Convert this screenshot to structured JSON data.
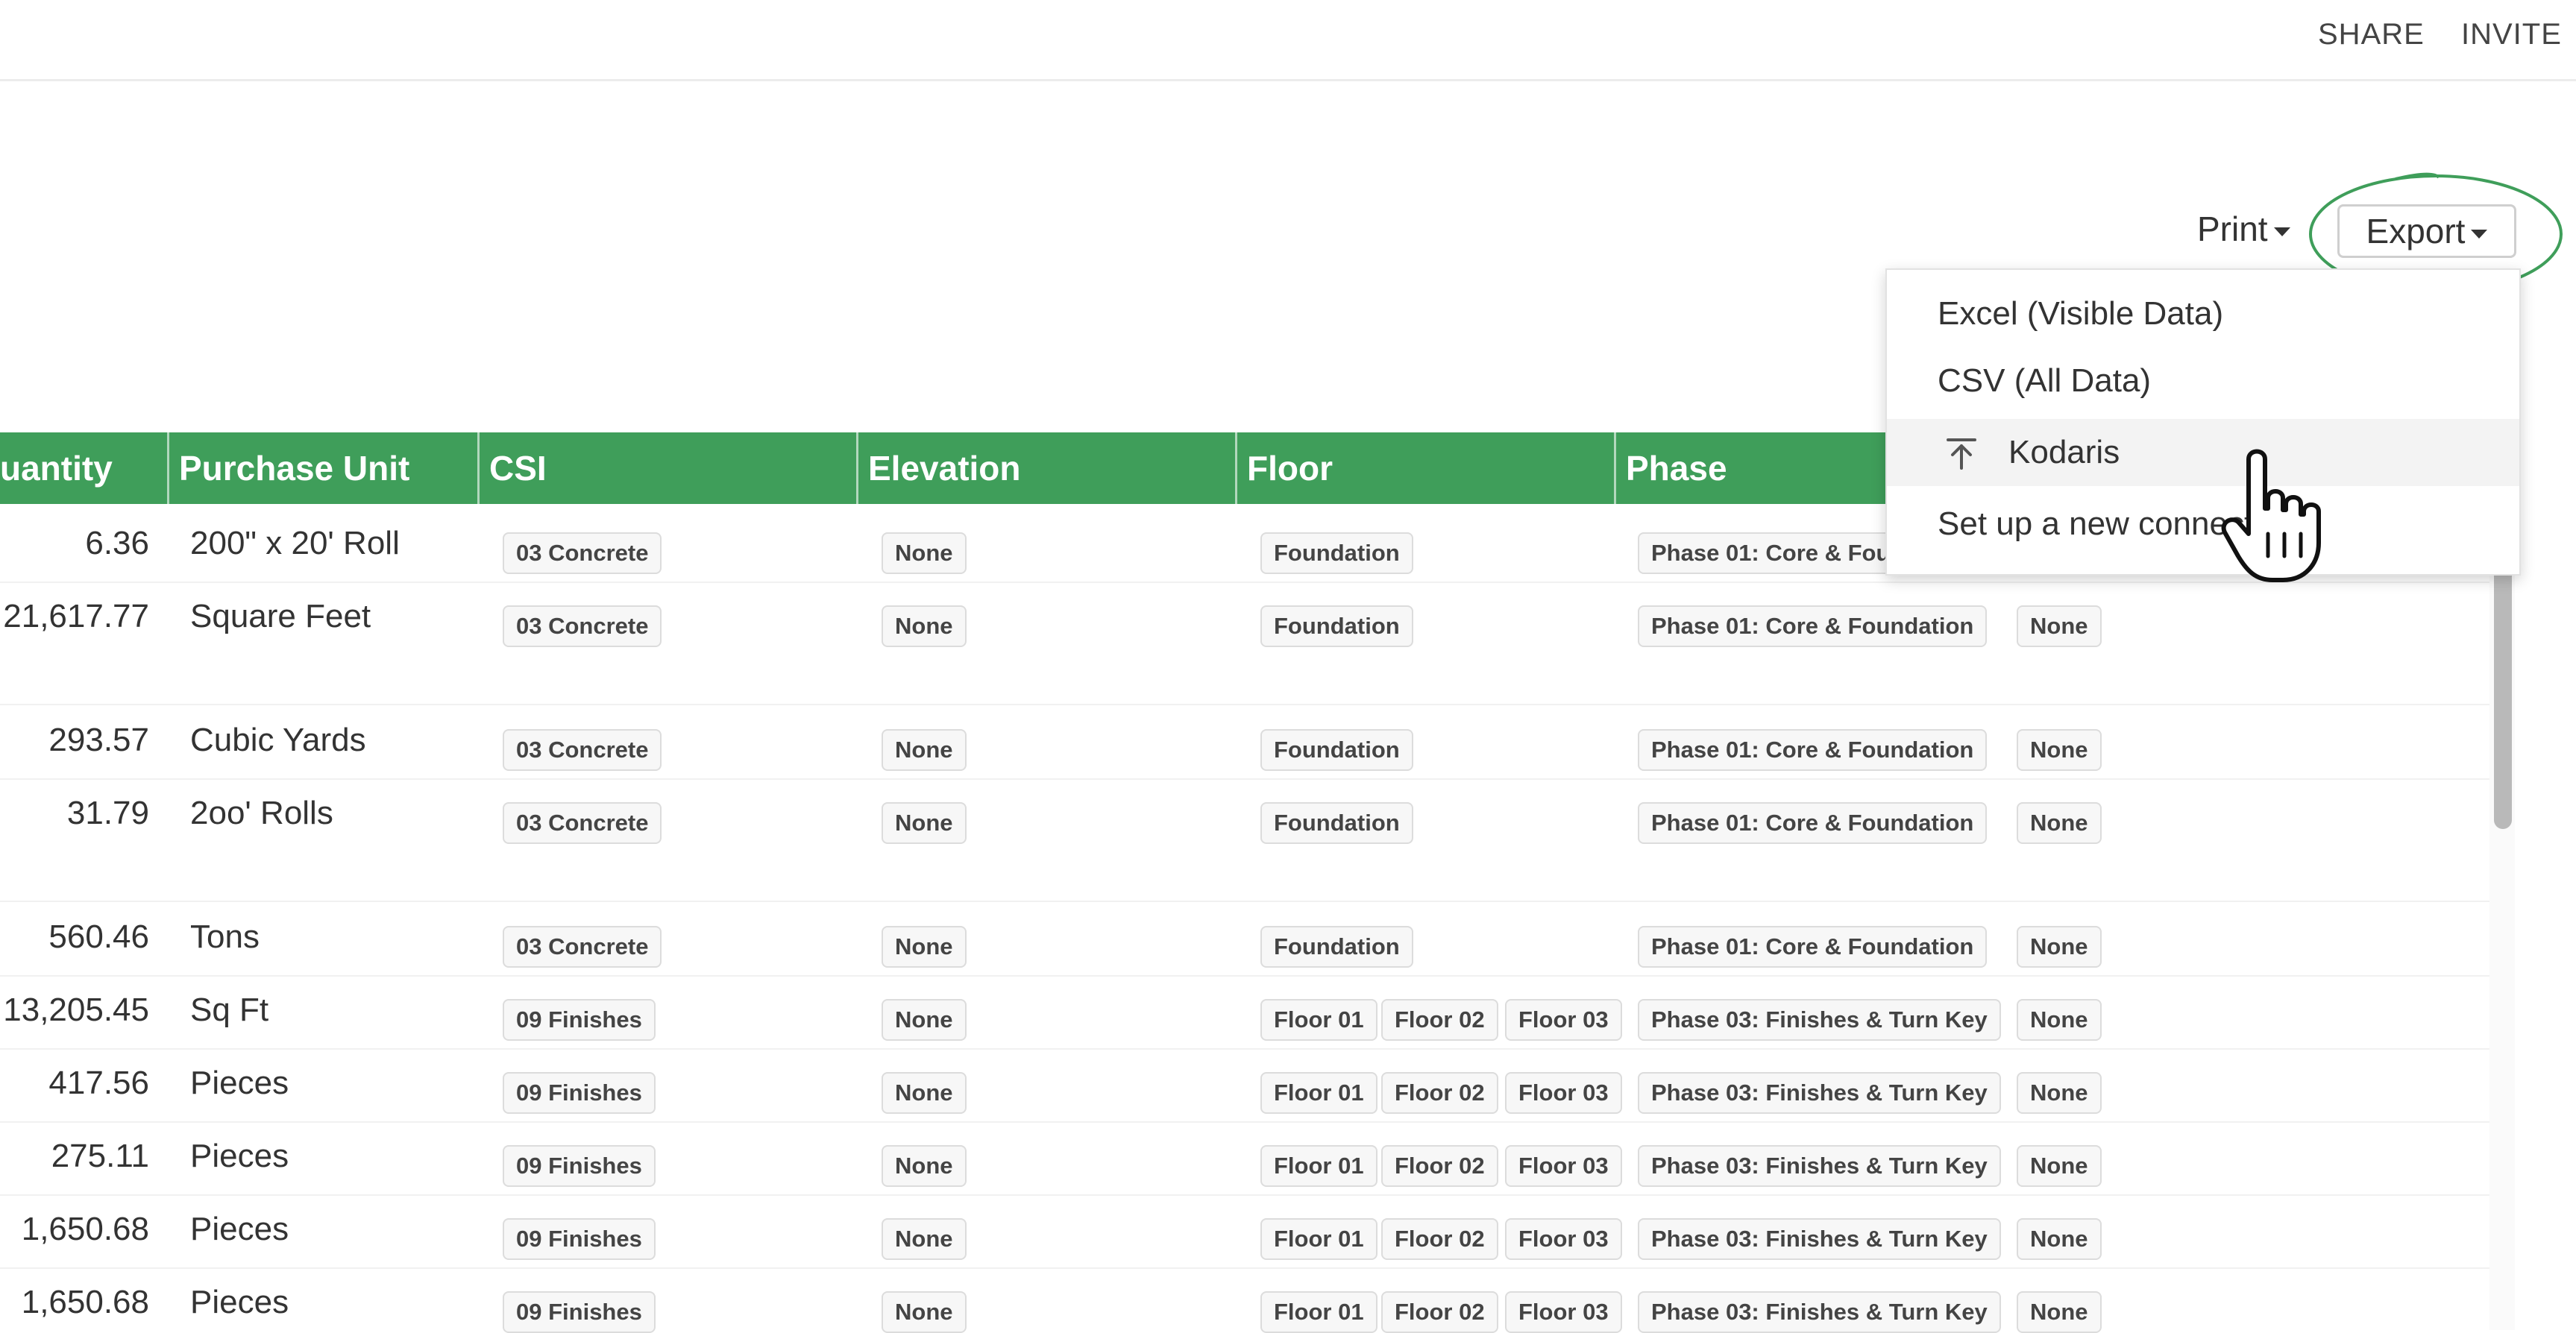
{
  "header": {
    "share_label": "SHARE",
    "invite_label": "INVITE"
  },
  "toolbar": {
    "print_label": "Print",
    "export_label": "Export"
  },
  "export_menu": {
    "items": [
      {
        "label": "Excel (Visible Data)"
      },
      {
        "label": "CSV (All Data)"
      },
      {
        "label": "Kodaris",
        "icon": "upload-icon"
      },
      {
        "label": "Set up a new connection."
      }
    ],
    "hovered_index": 2
  },
  "table": {
    "columns": [
      {
        "label": "uantity"
      },
      {
        "label": "Purchase Unit"
      },
      {
        "label": "CSI"
      },
      {
        "label": "Elevation"
      },
      {
        "label": "Floor"
      },
      {
        "label": "Phase"
      }
    ],
    "rows": [
      {
        "quantity": "6.36",
        "unit": "200\" x 20' Roll",
        "csi": "03 Concrete",
        "elevation": "None",
        "floors": [
          "Foundation"
        ],
        "phase": "Phase 01: Core & Foundation",
        "extra": ""
      },
      {
        "quantity": "21,617.77",
        "unit": "Square Feet",
        "csi": "03 Concrete",
        "elevation": "None",
        "floors": [
          "Foundation"
        ],
        "phase": "Phase 01: Core & Foundation",
        "extra": "None"
      },
      {
        "quantity": "293.57",
        "unit": "Cubic Yards",
        "csi": "03 Concrete",
        "elevation": "None",
        "floors": [
          "Foundation"
        ],
        "phase": "Phase 01: Core & Foundation",
        "extra": "None"
      },
      {
        "quantity": "31.79",
        "unit": "2oo' Rolls",
        "csi": "03 Concrete",
        "elevation": "None",
        "floors": [
          "Foundation"
        ],
        "phase": "Phase 01: Core & Foundation",
        "extra": "None"
      },
      {
        "quantity": "560.46",
        "unit": "Tons",
        "csi": "03 Concrete",
        "elevation": "None",
        "floors": [
          "Foundation"
        ],
        "phase": "Phase 01: Core & Foundation",
        "extra": "None"
      },
      {
        "quantity": "13,205.45",
        "unit": "Sq Ft",
        "csi": "09 Finishes",
        "elevation": "None",
        "floors": [
          "Floor 01",
          "Floor 02",
          "Floor 03"
        ],
        "phase": "Phase 03: Finishes & Turn Key",
        "extra": "None"
      },
      {
        "quantity": "417.56",
        "unit": "Pieces",
        "csi": "09 Finishes",
        "elevation": "None",
        "floors": [
          "Floor 01",
          "Floor 02",
          "Floor 03"
        ],
        "phase": "Phase 03: Finishes & Turn Key",
        "extra": "None"
      },
      {
        "quantity": "275.11",
        "unit": "Pieces",
        "csi": "09 Finishes",
        "elevation": "None",
        "floors": [
          "Floor 01",
          "Floor 02",
          "Floor 03"
        ],
        "phase": "Phase 03: Finishes & Turn Key",
        "extra": "None"
      },
      {
        "quantity": "1,650.68",
        "unit": "Pieces",
        "csi": "09 Finishes",
        "elevation": "None",
        "floors": [
          "Floor 01",
          "Floor 02",
          "Floor 03"
        ],
        "phase": "Phase 03: Finishes & Turn Key",
        "extra": "None"
      },
      {
        "quantity": "1,650.68",
        "unit": "Pieces",
        "csi": "09 Finishes",
        "elevation": "None",
        "floors": [
          "Floor 01",
          "Floor 02",
          "Floor 03"
        ],
        "phase": "Phase 03: Finishes & Turn Key",
        "extra": "None"
      }
    ]
  },
  "colors": {
    "header_green": "#3f9e5a",
    "annotation_green": "#3f9e5a"
  }
}
